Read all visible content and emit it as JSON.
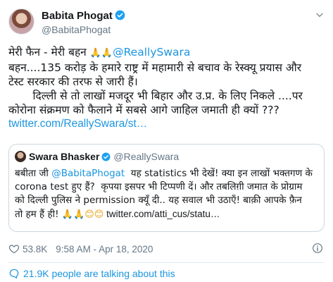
{
  "author": {
    "name": "Babita Phogat",
    "handle": "@BabitaPhogat"
  },
  "tweet": {
    "line1_prefix": "मेरी फैन - मेरी बहन ",
    "line1_emoji": "🙏🙏",
    "line1_mention": "@ReallySwara",
    "line2": "बहन....135 करोड़ के हमारे राष्ट्र में महामारी से बचाव के रेस्क्यू प्रयास और",
    "line3": "टेस्ट सरकार की तरफ से जारी हैं।",
    "line4": "       दिल्ली से तो लाखों मजदूर भी बिहार और उ.प्र. के लिए निकले ....पर",
    "line5": "कोरोना संक्रमण को फैलाने में सबसे आगे जाहिल जमाती ही क्यों ???",
    "link": "twitter.com/ReallySwara/st…"
  },
  "quote": {
    "name": "Swara Bhasker",
    "handle": "@ReallySwara",
    "line1_prefix": "बबीता जी ",
    "line1_mention": "@BabitaPhogat",
    "line1_suffix": "  यह statistics भी देखें! क्या इन लाखों भक्तगण के",
    "line2": "corona test हुए हैं?  कृपया इसपर भी टिप्पणी दें। और तबलिग़ी जमात के प्रोग्राम",
    "line3": "को दिल्ली पुलिस ने permission क्यूँ दी.. यह सवाल भी उठाएँ! बाक़ी आपके फ़ैन",
    "line4_prefix": "तो हम हैं ही! ",
    "line4_emoji": "🙏🙏😊😊",
    "line4_link": " twitter.com/atti_cus/statu…"
  },
  "meta": {
    "likes": "53.8K",
    "time": "9:58 AM - Apr 18, 2020"
  },
  "talking": "21.9K people are talking about this",
  "icons": {
    "verified": "verified-badge-icon",
    "chevron": "chevron-down-icon",
    "heart": "heart-icon",
    "info": "info-icon",
    "bubble": "speech-bubble-icon"
  },
  "colors": {
    "link": "#1b95e0",
    "secondary_text": "#657786",
    "border": "#ccd6dd"
  }
}
